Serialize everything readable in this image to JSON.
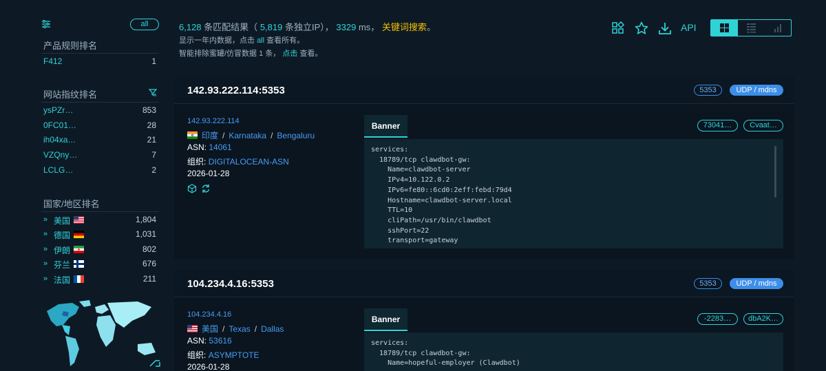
{
  "sidebar": {
    "filter_icon": "sliders-icon",
    "all_label": "all",
    "product_rank": {
      "title": "产品规则排名",
      "items": [
        {
          "name": "F412",
          "count": "1"
        }
      ]
    },
    "fingerprint_rank": {
      "title": "网站指纹排名",
      "filter_icon": "funnel-icon",
      "items": [
        {
          "name": "ysPZr…",
          "count": "853"
        },
        {
          "name": "0FC01…",
          "count": "28"
        },
        {
          "name": "ih04xa…",
          "count": "21"
        },
        {
          "name": "VZQny…",
          "count": "7"
        },
        {
          "name": "LCLG…",
          "count": "2"
        }
      ]
    },
    "country_rank": {
      "title": "国家/地区排名",
      "items": [
        {
          "name": "美国",
          "flag": "us-flag",
          "count": "1,804"
        },
        {
          "name": "德国",
          "flag": "de-flag",
          "count": "1,031"
        },
        {
          "name": "伊朗",
          "flag": "ir-flag",
          "count": "802"
        },
        {
          "name": "芬兰",
          "flag": "fi-flag",
          "count": "676"
        },
        {
          "name": "法国",
          "flag": "fr-flag",
          "count": "211"
        }
      ]
    }
  },
  "summary": {
    "match_count": "6,128",
    "match_text": "条匹配结果（",
    "ip_count": "5,819",
    "ip_text": "条独立IP），",
    "ms": "3329",
    "ms_text": "ms，",
    "keyword_search": "关键词搜索",
    "period": "。",
    "line2_pre": "显示一年内数据，点击",
    "line2_all": "all",
    "line2_post": "查看所有。",
    "line3_pre": "智能排除蜜罐/仿冒数据",
    "line3_num": "1",
    "line3_mid": "条，",
    "line3_click": "点击",
    "line3_post": "查看。"
  },
  "toolbar": {
    "icons": [
      "grid-plus-icon",
      "star-icon",
      "download-icon"
    ],
    "api_label": "API",
    "views": [
      "grid-view-icon",
      "list-view-icon",
      "chart-view-icon"
    ]
  },
  "results": [
    {
      "title": "142.93.222.114:5353",
      "port": "5353",
      "protocol": "UDP / mdns",
      "ip": "142.93.222.114",
      "country": "印度",
      "region": "Karnataka",
      "city": "Bengaluru",
      "asn_label": "ASN:",
      "asn": "14061",
      "org_label": "组织:",
      "org": "DIGITALOCEAN-ASN",
      "date": "2026-01-28",
      "banner_tab": "Banner",
      "hash1": "73041…",
      "hash2": "Cvaat…",
      "banner": "services:\n  18789/tcp clawdbot-gw:\n    Name=clawdbot-server\n    IPv4=10.122.0.2\n    IPv6=fe80::6cd0:2eff:febd:79d4\n    Hostname=clawdbot-server.local\n    TTL=10\n    cliPath=/usr/bin/clawdbot\n    sshPort=22\n    transport=gateway"
    },
    {
      "title": "104.234.4.16:5353",
      "port": "5353",
      "protocol": "UDP / mdns",
      "ip": "104.234.4.16",
      "country": "美国",
      "region": "Texas",
      "city": "Dallas",
      "asn_label": "ASN:",
      "asn": "53616",
      "org_label": "组织:",
      "org": "ASYMPTOTE",
      "date": "2026-01-28",
      "banner_tab": "Banner",
      "hash1": "-2283…",
      "hash2": "dbA2K…",
      "banner": "services:\n  18789/tcp clawdbot-gw:\n    Name=hopeful-employer (Clawdbot)"
    }
  ],
  "colors": {
    "accent": "#2fd3d6",
    "link": "#4a9cf0",
    "keyword": "#f5c000",
    "pill_blue": "#3d8ee8"
  }
}
